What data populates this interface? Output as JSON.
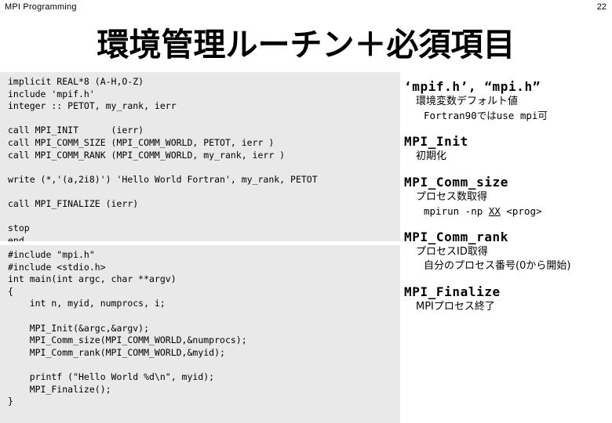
{
  "header": {
    "title": "MPI Programming",
    "page_number": "22"
  },
  "slide": {
    "title": "環境管理ルーチン＋必須項目"
  },
  "colors": {
    "page_background": "#ffffff",
    "code_panel_background": "#e9e9e9",
    "text": "#000000"
  },
  "fortran_code": {
    "language": "Fortran",
    "lines": [
      "implicit REAL*8 (A-H,O-Z)",
      "include 'mpif.h'",
      "integer :: PETOT, my_rank, ierr",
      "",
      "call MPI_INIT      (ierr)",
      "call MPI_COMM_SIZE (MPI_COMM_WORLD, PETOT, ierr )",
      "call MPI_COMM_RANK (MPI_COMM_WORLD, my_rank, ierr )",
      "",
      "write (*,'(a,2i8)') 'Hello World Fortran', my_rank, PETOT",
      "",
      "call MPI_FINALIZE (ierr)",
      "",
      "stop",
      "end"
    ]
  },
  "c_code": {
    "language": "C",
    "lines": [
      "#include \"mpi.h\"",
      "#include <stdio.h>",
      "int main(int argc, char **argv)",
      "{",
      "    int n, myid, numprocs, i;",
      "",
      "    MPI_Init(&argc,&argv);",
      "    MPI_Comm_size(MPI_COMM_WORLD,&numprocs);",
      "    MPI_Comm_rank(MPI_COMM_WORLD,&myid);",
      "",
      "    printf (\"Hello World %d\\n\", myid);",
      "    MPI_Finalize();",
      "}"
    ]
  },
  "notes": [
    {
      "heading": "‘mpif.h’, “mpi.h”",
      "subs": [
        {
          "text": "環境変数デフォルト値",
          "style": "kana"
        },
        {
          "text": "Fortran90ではuse mpi可",
          "style": "mono-deep"
        }
      ]
    },
    {
      "heading": "MPI_Init",
      "subs": [
        {
          "text": "初期化",
          "style": "kana"
        }
      ]
    },
    {
      "heading": "MPI_Comm_size",
      "subs": [
        {
          "text": "プロセス数取得",
          "style": "kana"
        },
        {
          "text": "mpirun -np XX <prog>",
          "style": "mono-deep",
          "underline_token": "XX"
        }
      ]
    },
    {
      "heading": "MPI_Comm_rank",
      "subs": [
        {
          "text": "プロセスID取得",
          "style": "kana"
        },
        {
          "text": "自分のプロセス番号(0から開始)",
          "style": "kana-deep"
        }
      ]
    },
    {
      "heading": "MPI_Finalize",
      "subs": [
        {
          "text": "MPIプロセス終了",
          "style": "kana"
        }
      ]
    }
  ]
}
